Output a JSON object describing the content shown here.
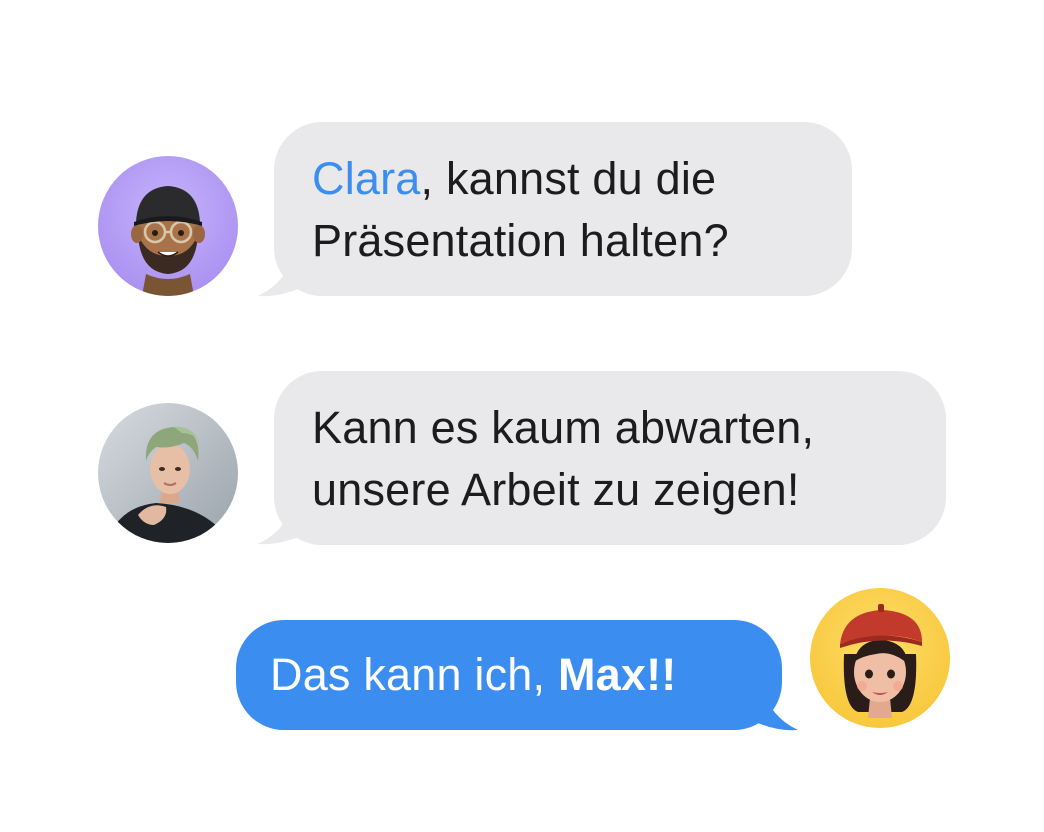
{
  "messages": [
    {
      "sender": "incoming",
      "mention": "Clara",
      "line1_rest": ", kannst du die",
      "line2": "Präsentation halten?",
      "bubble_color": "#e9e9eb",
      "mention_color": "#3b8ef0"
    },
    {
      "sender": "incoming",
      "line1": "Kann es kaum abwarten,",
      "line2": "unsere Arbeit zu zeigen!",
      "bubble_color": "#e9e9eb"
    },
    {
      "sender": "outgoing",
      "text_before": "Das kann ich, ",
      "mention": "Max!!",
      "bubble_color": "#3b8ef0"
    }
  ],
  "avatars": {
    "memoji_man_bg": "#b9a2f5",
    "memoji_woman_bg": "#ffd04a"
  }
}
